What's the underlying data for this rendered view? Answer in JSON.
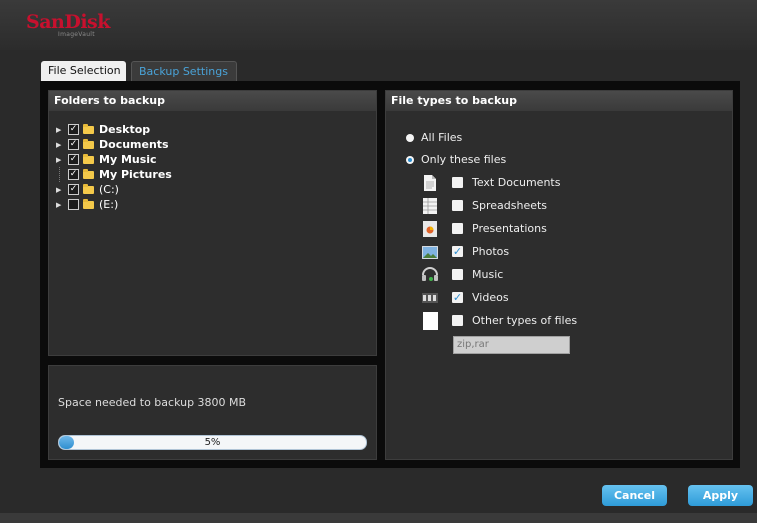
{
  "brand": {
    "name": "SanDisk",
    "product": "ImageVault",
    "color": "#c8102e"
  },
  "tabs": [
    {
      "label": "File Selection",
      "active": true
    },
    {
      "label": "Backup Settings",
      "active": false
    }
  ],
  "folders_panel": {
    "title": "Folders to backup",
    "items": [
      {
        "label": "Desktop",
        "checked": true,
        "expandable": true
      },
      {
        "label": "Documents",
        "checked": true,
        "expandable": true
      },
      {
        "label": "My Music",
        "checked": true,
        "expandable": true
      },
      {
        "label": "My Pictures",
        "checked": true,
        "expandable": false
      },
      {
        "label": "(C:)",
        "checked": true,
        "expandable": true
      },
      {
        "label": "(E:)",
        "checked": false,
        "expandable": true
      }
    ]
  },
  "space_panel": {
    "text": "Space needed to backup 3800 MB",
    "progress_percent": 5,
    "progress_label": "5%"
  },
  "filetypes_panel": {
    "title": "File types to backup",
    "options": [
      {
        "label": "All Files",
        "selected": false
      },
      {
        "label": "Only these files",
        "selected": true
      }
    ],
    "types": [
      {
        "label": "Text Documents",
        "checked": false,
        "icon": "text-document-icon"
      },
      {
        "label": "Spreadsheets",
        "checked": false,
        "icon": "spreadsheet-icon"
      },
      {
        "label": "Presentations",
        "checked": false,
        "icon": "presentation-icon"
      },
      {
        "label": "Photos",
        "checked": true,
        "icon": "photo-icon"
      },
      {
        "label": "Music",
        "checked": false,
        "icon": "music-icon"
      },
      {
        "label": "Videos",
        "checked": true,
        "icon": "video-icon"
      },
      {
        "label": "Other types of files",
        "checked": false,
        "icon": "blank-file-icon"
      }
    ],
    "other_extensions_value": "zip,rar"
  },
  "buttons": {
    "cancel": "Cancel",
    "apply": "Apply"
  },
  "colors": {
    "accent": "#2f8fd0",
    "tab_link": "#4aa3d8",
    "folder": "#f4c94a"
  }
}
